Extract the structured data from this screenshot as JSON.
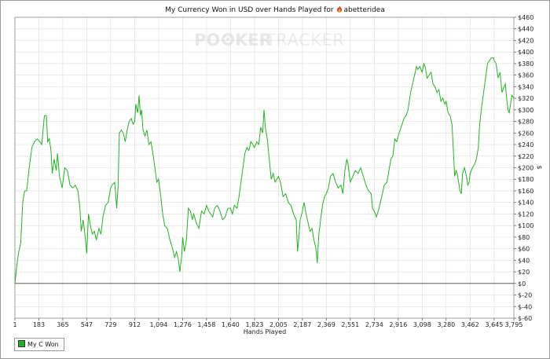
{
  "header": {
    "title_prefix": "My Currency Won in USD over Hands Played for",
    "player_name": "abetteridea",
    "player_icon": "flame-icon"
  },
  "watermark": {
    "text_poker": "PO",
    "text_ker": "KER",
    "text_tracker": "TRACKER",
    "icon": "poker-chip-icon"
  },
  "legend": {
    "label": "My C Won"
  },
  "colors": {
    "series": "#22b322",
    "grid": "#dcdcdc",
    "zero_line": "#444444"
  },
  "chart_data": {
    "type": "line",
    "title": "My Currency Won in USD over Hands Played for abetteridea",
    "xlabel": "Hands Played",
    "ylabel": "$",
    "xlim": [
      1,
      3795
    ],
    "ylim": [
      -60,
      460
    ],
    "x_ticks": [
      1,
      183,
      365,
      547,
      729,
      912,
      1094,
      1276,
      1458,
      1640,
      1823,
      2005,
      2187,
      2369,
      2551,
      2734,
      2916,
      3098,
      3280,
      3462,
      3645,
      3795
    ],
    "x_tick_labels": [
      "1",
      "183",
      "365",
      "547",
      "729",
      "912",
      "1,094",
      "1,276",
      "1,458",
      "1,640",
      "1,823",
      "2,005",
      "2,187",
      "2,369",
      "2,551",
      "2,734",
      "2,916",
      "3,098",
      "3,280",
      "3,462",
      "3,645",
      "3,795"
    ],
    "y_ticks": [
      -60,
      -40,
      -20,
      0,
      20,
      40,
      60,
      80,
      100,
      120,
      140,
      160,
      180,
      200,
      220,
      240,
      260,
      280,
      300,
      320,
      340,
      360,
      380,
      400,
      420,
      440,
      460
    ],
    "y_tick_labels": [
      "$-60",
      "$-40",
      "$-20",
      "$0",
      "$20",
      "$40",
      "$60",
      "$80",
      "$100",
      "$120",
      "$140",
      "$160",
      "$180",
      "$200",
      "$220",
      "$240",
      "$260",
      "$280",
      "$300",
      "$320",
      "$340",
      "$360",
      "$380",
      "$400",
      "$420",
      "$440",
      "$460"
    ],
    "y_axis_side": "right",
    "grid": true,
    "legend_position": "bottom-left",
    "series": [
      {
        "name": "My C Won",
        "color": "#22b322",
        "points": [
          [
            1,
            0
          ],
          [
            15,
            30
          ],
          [
            30,
            55
          ],
          [
            45,
            70
          ],
          [
            60,
            140
          ],
          [
            75,
            160
          ],
          [
            90,
            160
          ],
          [
            110,
            200
          ],
          [
            130,
            235
          ],
          [
            150,
            245
          ],
          [
            170,
            250
          ],
          [
            190,
            245
          ],
          [
            205,
            240
          ],
          [
            215,
            265
          ],
          [
            225,
            290
          ],
          [
            240,
            290
          ],
          [
            250,
            245
          ],
          [
            262,
            250
          ],
          [
            275,
            230
          ],
          [
            285,
            190
          ],
          [
            300,
            215
          ],
          [
            315,
            195
          ],
          [
            325,
            225
          ],
          [
            340,
            185
          ],
          [
            360,
            165
          ],
          [
            380,
            200
          ],
          [
            400,
            195
          ],
          [
            420,
            170
          ],
          [
            440,
            165
          ],
          [
            460,
            170
          ],
          [
            480,
            160
          ],
          [
            495,
            130
          ],
          [
            505,
            90
          ],
          [
            520,
            110
          ],
          [
            535,
            80
          ],
          [
            547,
            52
          ],
          [
            560,
            120
          ],
          [
            575,
            100
          ],
          [
            590,
            85
          ],
          [
            605,
            90
          ],
          [
            620,
            75
          ],
          [
            640,
            95
          ],
          [
            655,
            85
          ],
          [
            670,
            115
          ],
          [
            690,
            135
          ],
          [
            710,
            140
          ],
          [
            729,
            165
          ],
          [
            740,
            170
          ],
          [
            760,
            175
          ],
          [
            775,
            130
          ],
          [
            785,
            165
          ],
          [
            795,
            260
          ],
          [
            810,
            265
          ],
          [
            825,
            260
          ],
          [
            840,
            245
          ],
          [
            855,
            265
          ],
          [
            870,
            280
          ],
          [
            885,
            285
          ],
          [
            900,
            275
          ],
          [
            912,
            280
          ],
          [
            920,
            310
          ],
          [
            935,
            295
          ],
          [
            945,
            325
          ],
          [
            955,
            290
          ],
          [
            965,
            300
          ],
          [
            975,
            265
          ],
          [
            990,
            255
          ],
          [
            1005,
            265
          ],
          [
            1020,
            240
          ],
          [
            1035,
            245
          ],
          [
            1050,
            225
          ],
          [
            1065,
            200
          ],
          [
            1080,
            175
          ],
          [
            1094,
            180
          ],
          [
            1110,
            150
          ],
          [
            1125,
            120
          ],
          [
            1140,
            100
          ],
          [
            1160,
            95
          ],
          [
            1180,
            75
          ],
          [
            1200,
            60
          ],
          [
            1215,
            45
          ],
          [
            1230,
            55
          ],
          [
            1245,
            40
          ],
          [
            1255,
            20
          ],
          [
            1270,
            50
          ],
          [
            1276,
            80
          ],
          [
            1290,
            55
          ],
          [
            1305,
            75
          ],
          [
            1320,
            130
          ],
          [
            1335,
            125
          ],
          [
            1350,
            110
          ],
          [
            1360,
            120
          ],
          [
            1380,
            105
          ],
          [
            1400,
            95
          ],
          [
            1420,
            125
          ],
          [
            1440,
            120
          ],
          [
            1458,
            135
          ],
          [
            1475,
            125
          ],
          [
            1490,
            120
          ],
          [
            1505,
            115
          ],
          [
            1520,
            130
          ],
          [
            1540,
            135
          ],
          [
            1560,
            125
          ],
          [
            1580,
            110
          ],
          [
            1600,
            115
          ],
          [
            1620,
            130
          ],
          [
            1640,
            130
          ],
          [
            1655,
            120
          ],
          [
            1670,
            135
          ],
          [
            1690,
            130
          ],
          [
            1705,
            150
          ],
          [
            1720,
            175
          ],
          [
            1735,
            200
          ],
          [
            1750,
            225
          ],
          [
            1765,
            235
          ],
          [
            1780,
            230
          ],
          [
            1795,
            245
          ],
          [
            1810,
            240
          ],
          [
            1823,
            235
          ],
          [
            1840,
            245
          ],
          [
            1855,
            240
          ],
          [
            1870,
            270
          ],
          [
            1885,
            260
          ],
          [
            1895,
            300
          ],
          [
            1905,
            270
          ],
          [
            1920,
            250
          ],
          [
            1935,
            215
          ],
          [
            1950,
            180
          ],
          [
            1965,
            190
          ],
          [
            1980,
            175
          ],
          [
            2005,
            185
          ],
          [
            2020,
            175
          ],
          [
            2040,
            150
          ],
          [
            2060,
            155
          ],
          [
            2080,
            140
          ],
          [
            2100,
            135
          ],
          [
            2120,
            120
          ],
          [
            2140,
            110
          ],
          [
            2150,
            55
          ],
          [
            2160,
            80
          ],
          [
            2170,
            110
          ],
          [
            2187,
            125
          ],
          [
            2200,
            140
          ],
          [
            2215,
            120
          ],
          [
            2230,
            105
          ],
          [
            2245,
            90
          ],
          [
            2260,
            95
          ],
          [
            2275,
            75
          ],
          [
            2290,
            60
          ],
          [
            2300,
            35
          ],
          [
            2310,
            80
          ],
          [
            2325,
            110
          ],
          [
            2340,
            135
          ],
          [
            2355,
            150
          ],
          [
            2369,
            155
          ],
          [
            2385,
            165
          ],
          [
            2400,
            185
          ],
          [
            2420,
            190
          ],
          [
            2440,
            175
          ],
          [
            2460,
            165
          ],
          [
            2480,
            170
          ],
          [
            2495,
            155
          ],
          [
            2510,
            195
          ],
          [
            2525,
            215
          ],
          [
            2535,
            205
          ],
          [
            2551,
            175
          ],
          [
            2570,
            185
          ],
          [
            2590,
            195
          ],
          [
            2610,
            190
          ],
          [
            2630,
            200
          ],
          [
            2650,
            185
          ],
          [
            2670,
            170
          ],
          [
            2690,
            160
          ],
          [
            2710,
            155
          ],
          [
            2720,
            130
          ],
          [
            2734,
            125
          ],
          [
            2750,
            115
          ],
          [
            2770,
            130
          ],
          [
            2790,
            150
          ],
          [
            2810,
            170
          ],
          [
            2830,
            175
          ],
          [
            2845,
            195
          ],
          [
            2860,
            215
          ],
          [
            2875,
            220
          ],
          [
            2890,
            250
          ],
          [
            2905,
            245
          ],
          [
            2916,
            255
          ],
          [
            2930,
            265
          ],
          [
            2945,
            275
          ],
          [
            2960,
            285
          ],
          [
            2975,
            290
          ],
          [
            2990,
            300
          ],
          [
            3010,
            330
          ],
          [
            3025,
            345
          ],
          [
            3040,
            360
          ],
          [
            3055,
            375
          ],
          [
            3065,
            370
          ],
          [
            3080,
            375
          ],
          [
            3098,
            365
          ],
          [
            3110,
            380
          ],
          [
            3120,
            375
          ],
          [
            3135,
            355
          ],
          [
            3150,
            360
          ],
          [
            3165,
            365
          ],
          [
            3180,
            345
          ],
          [
            3195,
            340
          ],
          [
            3210,
            330
          ],
          [
            3225,
            335
          ],
          [
            3240,
            315
          ],
          [
            3255,
            320
          ],
          [
            3270,
            310
          ],
          [
            3280,
            315
          ],
          [
            3295,
            295
          ],
          [
            3310,
            290
          ],
          [
            3325,
            275
          ],
          [
            3335,
            230
          ],
          [
            3345,
            185
          ],
          [
            3355,
            195
          ],
          [
            3365,
            190
          ],
          [
            3375,
            175
          ],
          [
            3385,
            160
          ],
          [
            3395,
            155
          ],
          [
            3405,
            190
          ],
          [
            3420,
            200
          ],
          [
            3435,
            185
          ],
          [
            3445,
            170
          ],
          [
            3455,
            175
          ],
          [
            3462,
            190
          ],
          [
            3480,
            200
          ],
          [
            3495,
            205
          ],
          [
            3510,
            215
          ],
          [
            3525,
            235
          ],
          [
            3535,
            275
          ],
          [
            3550,
            305
          ],
          [
            3565,
            330
          ],
          [
            3580,
            355
          ],
          [
            3595,
            380
          ],
          [
            3610,
            385
          ],
          [
            3625,
            390
          ],
          [
            3640,
            390
          ],
          [
            3645,
            385
          ],
          [
            3660,
            380
          ],
          [
            3675,
            355
          ],
          [
            3690,
            365
          ],
          [
            3705,
            330
          ],
          [
            3720,
            340
          ],
          [
            3730,
            345
          ],
          [
            3740,
            320
          ],
          [
            3750,
            300
          ],
          [
            3760,
            295
          ],
          [
            3770,
            310
          ],
          [
            3780,
            325
          ],
          [
            3795,
            320
          ]
        ]
      }
    ]
  }
}
